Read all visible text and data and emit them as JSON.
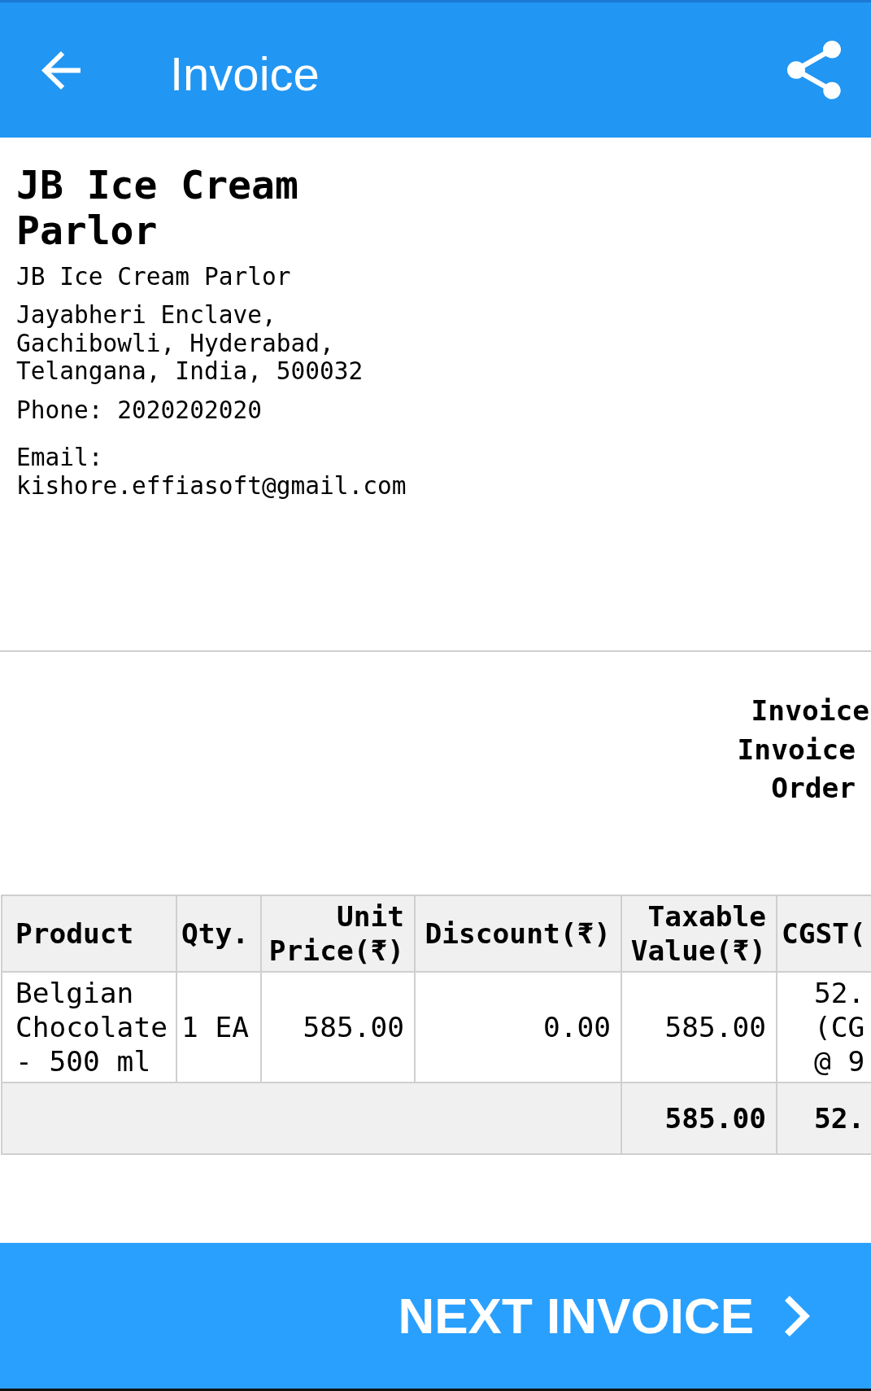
{
  "app_bar": {
    "title": "Invoice"
  },
  "store": {
    "name": "JB Ice Cream Parlor",
    "legal_name": "JB Ice Cream Parlor",
    "address": "Jayabheri Enclave, Gachibowli, Hyderabad, Telangana, India, 500032",
    "phone": "Phone: 2020202020",
    "email": "Email: kishore.effiasoft@gmail.com"
  },
  "invoice_labels": [
    "Invoice",
    "Invoice",
    "Order"
  ],
  "table": {
    "columns": [
      "Product",
      "Qty.",
      "Unit Price(₹)",
      "Discount(₹)",
      "Taxable Value(₹)",
      "CGST("
    ],
    "rows": [
      [
        "Belgian Chocolate - 500 ml",
        "1 EA",
        "585.00",
        "0.00",
        "585.00",
        "52. (CG @ 9"
      ]
    ],
    "totals": [
      "585.00",
      "52."
    ]
  },
  "footer_button": {
    "label": "NEXT INVOICE"
  }
}
